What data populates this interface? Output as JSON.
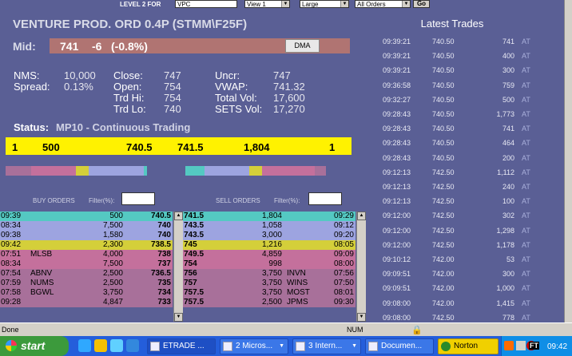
{
  "toolbar": {
    "level2_label": "LEVEL 2 FOR",
    "symbol_value": "VPC",
    "view_value": "View 1",
    "size_value": "Large",
    "orders_value": "All Orders",
    "go_label": "Go"
  },
  "instrument": {
    "title": "VENTURE PROD. ORD 0.4P (STMM\\F25F)",
    "mid_label": "Mid:",
    "mid_value": "741",
    "change": "-6",
    "change_pct": "(-0.8%)",
    "dma_label": "DMA"
  },
  "stats": {
    "nms_label": "NMS:",
    "nms_value": "10,000",
    "spread_label": "Spread:",
    "spread_value": "0.13%",
    "close_label": "Close:",
    "close_value": "747",
    "open_label": "Open:",
    "open_value": "754",
    "trdhi_label": "Trd Hi:",
    "trdhi_value": "754",
    "trdlo_label": "Trd Lo:",
    "trdlo_value": "740",
    "uncr_label": "Uncr:",
    "uncr_value": "747",
    "vwap_label": "VWAP:",
    "vwap_value": "741.32",
    "totalvol_label": "Total Vol:",
    "totalvol_value": "17,600",
    "setsvol_label": "SETS Vol:",
    "setsvol_value": "17,270"
  },
  "status": {
    "label": "Status:",
    "value": "MP10 - Continuous Trading"
  },
  "touch": {
    "bid_count": "1",
    "bid_size": "500",
    "bid": "740.5",
    "ask": "741.5",
    "ask_size": "1,804",
    "ask_count": "1"
  },
  "buy_orders": {
    "header": "BUY ORDERS",
    "filter_label": "Filter(%):",
    "rows": [
      {
        "time": "09:39",
        "mm": "",
        "size": "500",
        "price": "740.5"
      },
      {
        "time": "08:34",
        "mm": "",
        "size": "7,500",
        "price": "740"
      },
      {
        "time": "09:38",
        "mm": "",
        "size": "1,580",
        "price": "740"
      },
      {
        "time": "09:42",
        "mm": "",
        "size": "2,300",
        "price": "738.5"
      },
      {
        "time": "07:51",
        "mm": "MLSB",
        "size": "4,000",
        "price": "738"
      },
      {
        "time": "08:34",
        "mm": "",
        "size": "7,500",
        "price": "737"
      },
      {
        "time": "07:54",
        "mm": "ABNV",
        "size": "2,500",
        "price": "736.5"
      },
      {
        "time": "07:59",
        "mm": "NUMS",
        "size": "2,500",
        "price": "735"
      },
      {
        "time": "07:58",
        "mm": "BGWL",
        "size": "3,750",
        "price": "734"
      },
      {
        "time": "09:28",
        "mm": "",
        "size": "4,847",
        "price": "733"
      }
    ]
  },
  "sell_orders": {
    "header": "SELL ORDERS",
    "filter_label": "Filter(%):",
    "rows": [
      {
        "price": "741.5",
        "size": "1,804",
        "mm": "",
        "time": "09:29"
      },
      {
        "price": "743.5",
        "size": "1,058",
        "mm": "",
        "time": "09:12"
      },
      {
        "price": "743.5",
        "size": "3,000",
        "mm": "",
        "time": "09:20"
      },
      {
        "price": "745",
        "size": "1,216",
        "mm": "",
        "time": "08:05"
      },
      {
        "price": "749.5",
        "size": "4,859",
        "mm": "",
        "time": "09:09"
      },
      {
        "price": "754",
        "size": "998",
        "mm": "",
        "time": "08:00"
      },
      {
        "price": "756",
        "size": "3,750",
        "mm": "INVN",
        "time": "07:56"
      },
      {
        "price": "757",
        "size": "3,750",
        "mm": "WINS",
        "time": "07:50"
      },
      {
        "price": "757.5",
        "size": "3,750",
        "mm": "MOST",
        "time": "08:01"
      },
      {
        "price": "757.5",
        "size": "2,500",
        "mm": "JPMS",
        "time": "09:30"
      }
    ]
  },
  "latest_trades": {
    "title": "Latest Trades",
    "rows": [
      {
        "time": "09:39:21",
        "price": "740.50",
        "size": "741",
        "type": "AT"
      },
      {
        "time": "09:39:21",
        "price": "740.50",
        "size": "400",
        "type": "AT"
      },
      {
        "time": "09:39:21",
        "price": "740.50",
        "size": "300",
        "type": "AT"
      },
      {
        "time": "09:36:58",
        "price": "740.50",
        "size": "759",
        "type": "AT"
      },
      {
        "time": "09:32:27",
        "price": "740.50",
        "size": "500",
        "type": "AT"
      },
      {
        "time": "09:28:43",
        "price": "740.50",
        "size": "1,773",
        "type": "AT"
      },
      {
        "time": "09:28:43",
        "price": "740.50",
        "size": "741",
        "type": "AT"
      },
      {
        "time": "09:28:43",
        "price": "740.50",
        "size": "464",
        "type": "AT"
      },
      {
        "time": "09:28:43",
        "price": "740.50",
        "size": "200",
        "type": "AT"
      },
      {
        "time": "09:12:13",
        "price": "742.50",
        "size": "1,112",
        "type": "AT"
      },
      {
        "time": "09:12:13",
        "price": "742.50",
        "size": "240",
        "type": "AT"
      },
      {
        "time": "09:12:13",
        "price": "742.50",
        "size": "100",
        "type": "AT"
      },
      {
        "time": "09:12:00",
        "price": "742.50",
        "size": "302",
        "type": "AT"
      },
      {
        "time": "09:12:00",
        "price": "742.50",
        "size": "1,298",
        "type": "AT"
      },
      {
        "time": "09:12:00",
        "price": "742.50",
        "size": "1,178",
        "type": "AT"
      },
      {
        "time": "09:10:12",
        "price": "742.00",
        "size": "53",
        "type": "AT"
      },
      {
        "time": "09:09:51",
        "price": "742.00",
        "size": "300",
        "type": "AT"
      },
      {
        "time": "09:09:51",
        "price": "742.00",
        "size": "1,000",
        "type": "AT"
      },
      {
        "time": "09:08:00",
        "price": "742.00",
        "size": "1,415",
        "type": "AT"
      },
      {
        "time": "09:08:00",
        "price": "742.50",
        "size": "778",
        "type": "AT"
      }
    ]
  },
  "statusbar": {
    "left": "Done",
    "num": "NUM"
  },
  "taskbar": {
    "start": "start",
    "tasks": [
      {
        "label": "ETRADE ..."
      },
      {
        "label": "2 Micros..."
      },
      {
        "label": "3 Intern..."
      },
      {
        "label": "Documen..."
      },
      {
        "label": "Norton"
      }
    ],
    "ft": "FT",
    "clock": "09:42"
  },
  "colors": {
    "background": "#5a5f95",
    "level1": "#54c9c2",
    "level2": "#9da4e0",
    "level3": "#d4cf3a",
    "level4": "#c4709c",
    "level5": "#a8709a",
    "touch_bar": "#fff200",
    "mid_bar": "#b07472"
  }
}
